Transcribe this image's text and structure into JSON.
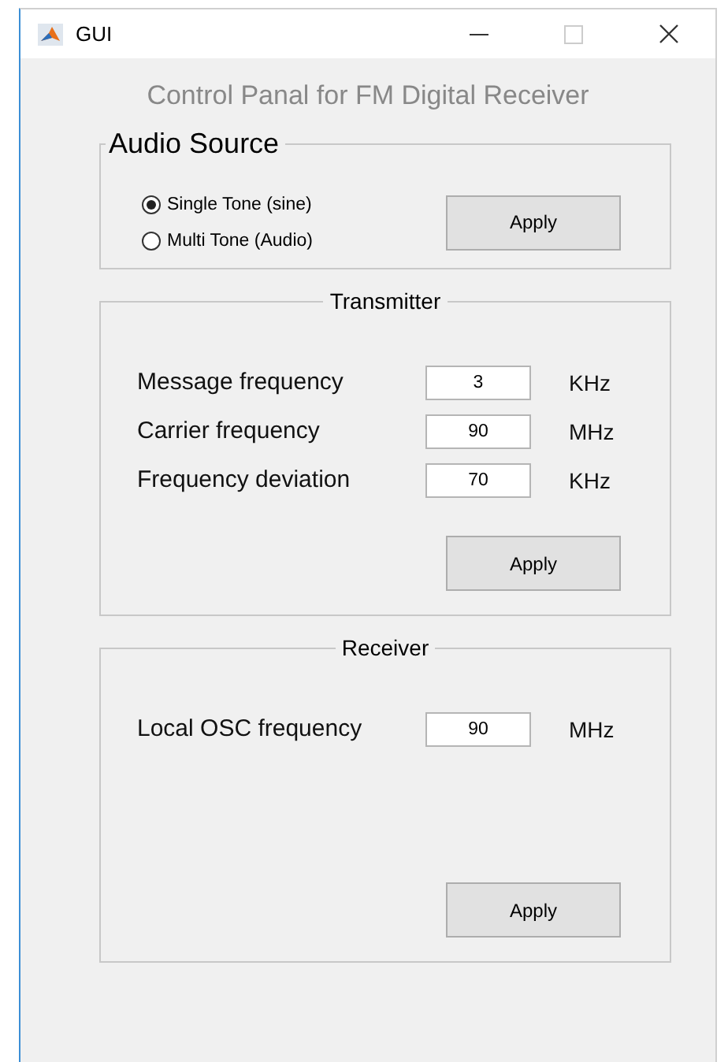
{
  "window": {
    "title": "GUI"
  },
  "heading": "Control Panal for FM Digital Receiver",
  "panels": [
    {
      "kind": "radio",
      "title": "Audio Source",
      "options": [
        {
          "label": "Single Tone (sine)",
          "selected": true
        },
        {
          "label": "Multi Tone (Audio)",
          "selected": false
        }
      ],
      "button": "Apply"
    },
    {
      "kind": "fields",
      "title": "Transmitter",
      "fields": [
        {
          "label": "Message frequency",
          "value": "3",
          "unit": "KHz"
        },
        {
          "label": "Carrier frequency",
          "value": "90",
          "unit": "MHz"
        },
        {
          "label": "Frequency deviation",
          "value": "70",
          "unit": "KHz"
        }
      ],
      "button": "Apply"
    },
    {
      "kind": "fields",
      "title": "Receiver",
      "fields": [
        {
          "label": "Local OSC frequency",
          "value": "90",
          "unit": "MHz"
        }
      ],
      "button": "Apply"
    }
  ]
}
